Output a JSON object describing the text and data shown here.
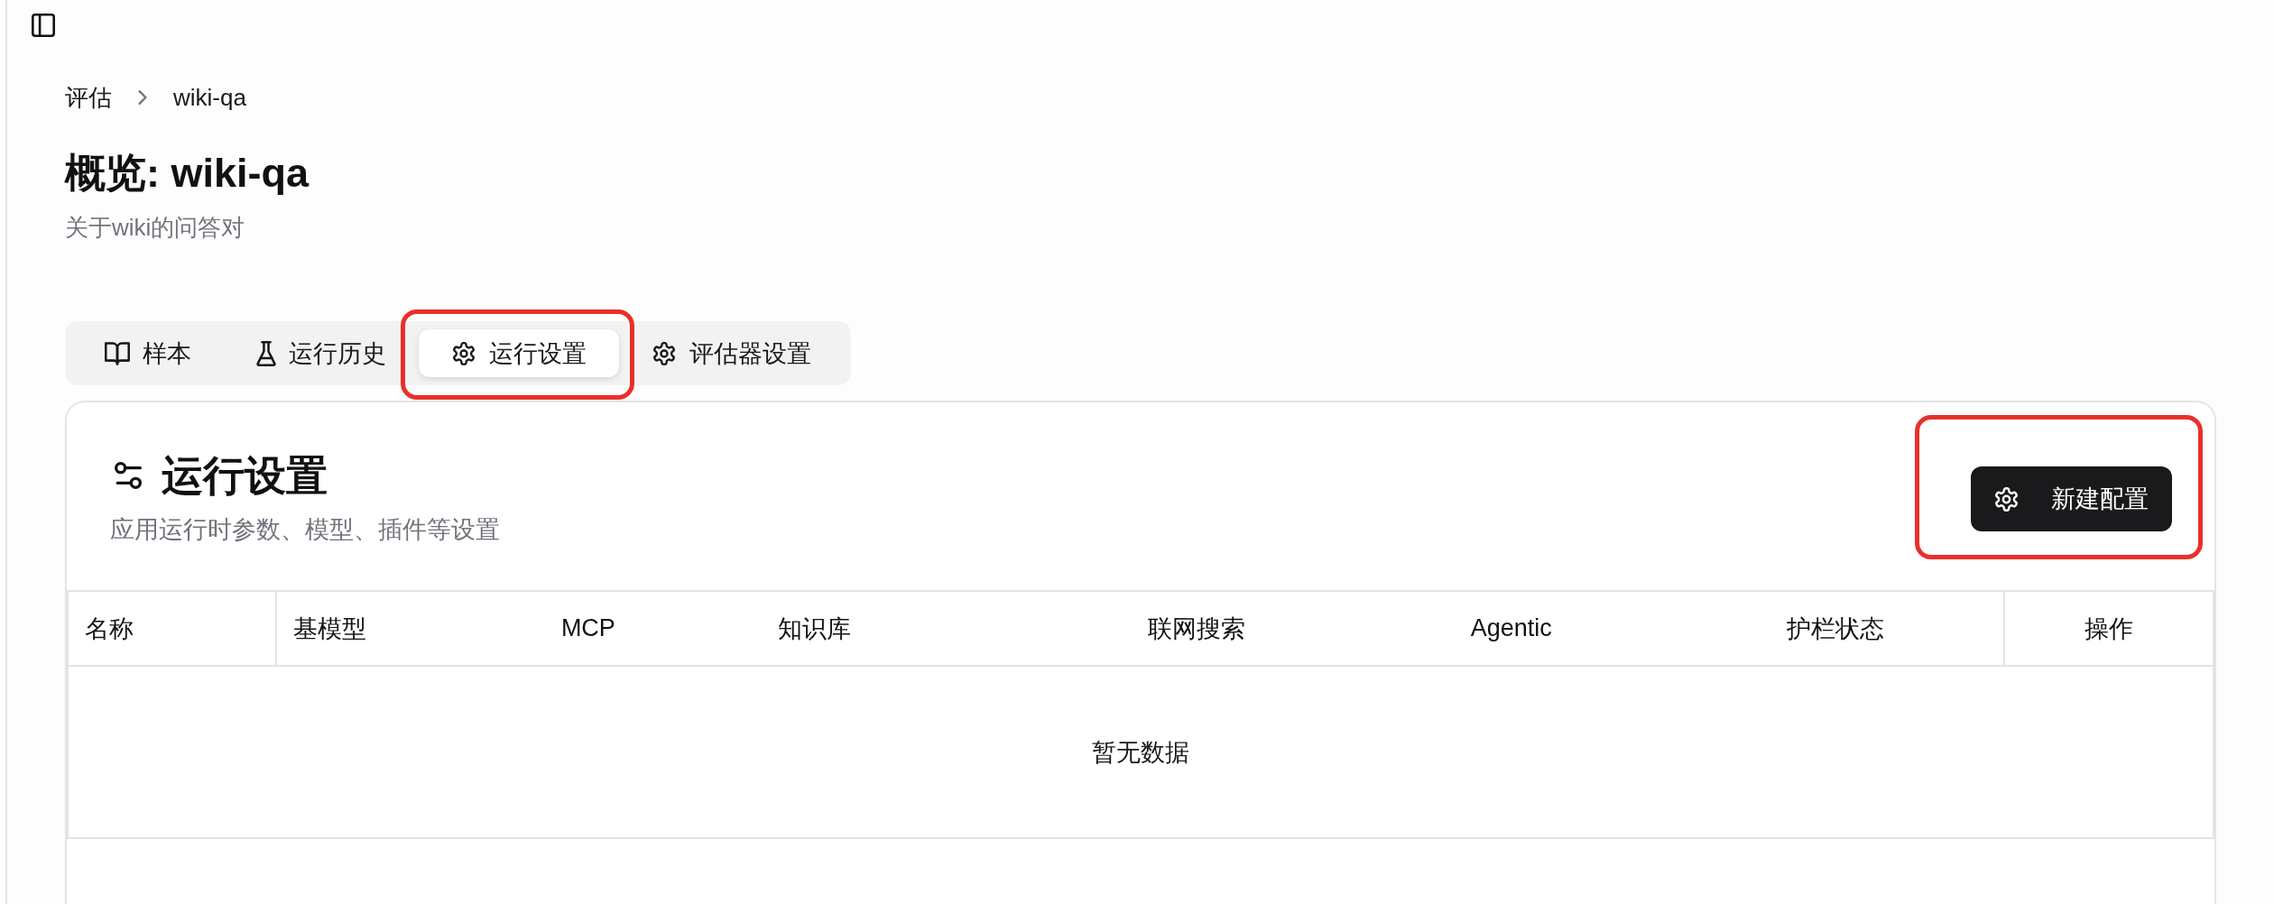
{
  "breadcrumb": [
    {
      "label": "评估"
    },
    {
      "label": "wiki-qa"
    }
  ],
  "page": {
    "title": "概览: wiki-qa",
    "subtitle": "关于wiki的问答对"
  },
  "tabs": [
    {
      "label": "样本",
      "selected": false,
      "highlighted": false
    },
    {
      "label": "运行历史",
      "selected": false,
      "highlighted": false
    },
    {
      "label": "运行设置",
      "selected": true,
      "highlighted": true
    },
    {
      "label": "评估器设置",
      "selected": false,
      "highlighted": false
    }
  ],
  "panel": {
    "title": "运行设置",
    "subtitle": "应用运行时参数、模型、插件等设置",
    "button": {
      "label": "新建配置",
      "highlighted": true
    }
  },
  "table": {
    "columns": [
      "名称",
      "基模型",
      "MCP",
      "知识库",
      "联网搜索",
      "Agentic",
      "护栏状态",
      "操作"
    ],
    "empty_text": "暂无数据"
  }
}
